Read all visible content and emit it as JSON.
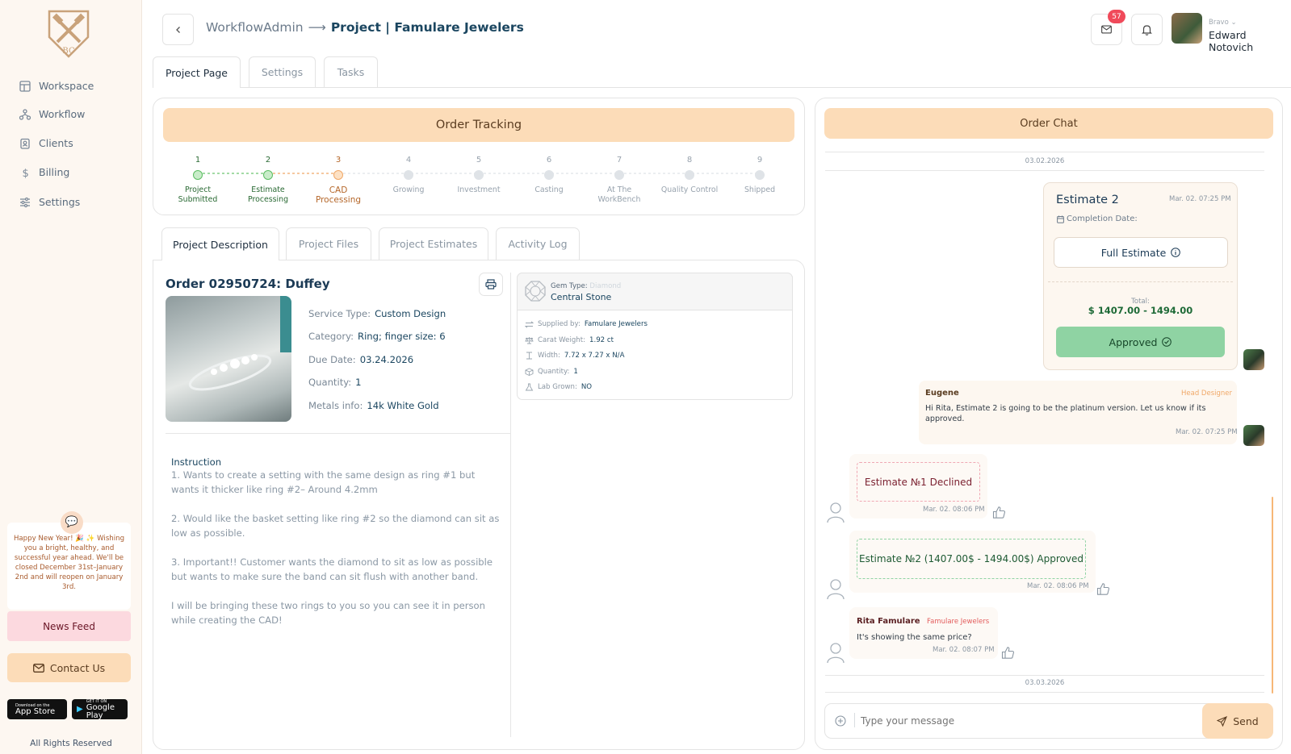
{
  "sidebar": {
    "logo_text": "BC",
    "items": [
      {
        "label": "Workspace",
        "icon": "workspace-icon"
      },
      {
        "label": "Workflow",
        "icon": "workflow-icon"
      },
      {
        "label": "Clients",
        "icon": "clients-icon"
      },
      {
        "label": "Billing",
        "icon": "billing-icon"
      },
      {
        "label": "Settings",
        "icon": "settings-icon"
      }
    ],
    "news_text": "Happy New Year! 🎉 ✨ Wishing you a bright, healthy, and successful year ahead. We'll be closed December 31st–January 2nd and will reopen on January 3rd.",
    "news_button": "News Feed",
    "contact_button": "Contact Us",
    "app_store_small": "Download on the",
    "app_store": "App Store",
    "google_play_small": "GET IT ON",
    "google_play": "Google Play",
    "rights": "All Rights Reserved"
  },
  "header": {
    "breadcrumb_root": "WorkflowAdmin",
    "breadcrumb_arrow": "⟶",
    "breadcrumb_page": "Project | Famulare Jewelers",
    "mail_badge": "57",
    "user_company": "Bravo",
    "user_name": "Edward Notovich"
  },
  "tabs": [
    "Project Page",
    "Settings",
    "Tasks"
  ],
  "tracking": {
    "title": "Order Tracking",
    "steps": [
      {
        "num": "1",
        "label": "Project Submitted",
        "status": "done"
      },
      {
        "num": "2",
        "label": "Estimate Processing",
        "status": "done"
      },
      {
        "num": "3",
        "label": "CAD Processing",
        "status": "current"
      },
      {
        "num": "4",
        "label": "Growing",
        "status": "pending"
      },
      {
        "num": "5",
        "label": "Investment",
        "status": "pending"
      },
      {
        "num": "6",
        "label": "Casting",
        "status": "pending"
      },
      {
        "num": "7",
        "label": "At The WorkBench",
        "status": "pending"
      },
      {
        "num": "8",
        "label": "Quality Control",
        "status": "pending"
      },
      {
        "num": "9",
        "label": "Shipped",
        "status": "pending"
      }
    ]
  },
  "subtabs": [
    "Project Description",
    "Project Files",
    "Project Estimates",
    "Activity Log"
  ],
  "order": {
    "title": "Order 02950724: Duffey",
    "fields": [
      {
        "label": "Service Type:",
        "value": "Custom Design"
      },
      {
        "label": "Category:",
        "value": "Ring; finger size: 6"
      },
      {
        "label": "Due Date:",
        "value": "03.24.2026"
      },
      {
        "label": "Quantity:",
        "value": "1"
      },
      {
        "label": "Metals info:",
        "value": "14k White Gold"
      }
    ],
    "instruction_title": "Instruction",
    "instructions": [
      "1. Wants to create a setting with the same design as ring #1 but wants it thicker like ring #2– Around 4.2mm",
      "2. Would like the basket setting like ring #2 so the diamond can sit as low as possible.",
      "3. Important!! Customer wants the diamond to sit as low as possible but wants to make sure the band can sit flush with another band.",
      "I will be bringing these two rings to you so you can see it in person while creating the CAD!"
    ]
  },
  "gem": {
    "type_label": "Gem Type:",
    "type_value": "Diamond",
    "name": "Central Stone",
    "rows": [
      {
        "label": "Supplied by:",
        "value": "Famulare Jewelers"
      },
      {
        "label": "Carat Weight:",
        "value": "1.92 ct"
      },
      {
        "label": "Width:",
        "value": "7.72 x 7.27 x N/A"
      },
      {
        "label": "Quantity:",
        "value": "1"
      },
      {
        "label": "Lab Grown:",
        "value": "NO"
      }
    ]
  },
  "chat": {
    "title": "Order Chat",
    "date1": "03.02.2026",
    "estimate_title": "Estimate 2",
    "estimate_time": "Mar. 02. 07:25 PM",
    "completion_label": "Completion Date:",
    "full_estimate": "Full Estimate",
    "total_label": "Total:",
    "total_value": "$ 1407.00 - 1494.00",
    "approved": "Approved",
    "eugene_name": "Eugene",
    "eugene_role": "Head Designer",
    "eugene_text": "Hi Rita, Estimate 2 is going to be the platinum version. Let us know if its approved.",
    "eugene_time": "Mar. 02. 07:25 PM",
    "declined_text": "Estimate №1 Declined",
    "declined_time": "Mar. 02. 08:06 PM",
    "approved_text": "Estimate №2 (1407.00$ - 1494.00$) Approved",
    "approved_time": "Mar. 02. 08:06 PM",
    "rita_name": "Rita Famulare",
    "rita_company": "Famulare Jewelers",
    "rita_text": "It's showing the same price?",
    "rita_time": "Mar. 02. 08:07 PM",
    "date2": "03.03.2026",
    "input_placeholder": "Type your message",
    "send": "Send"
  }
}
